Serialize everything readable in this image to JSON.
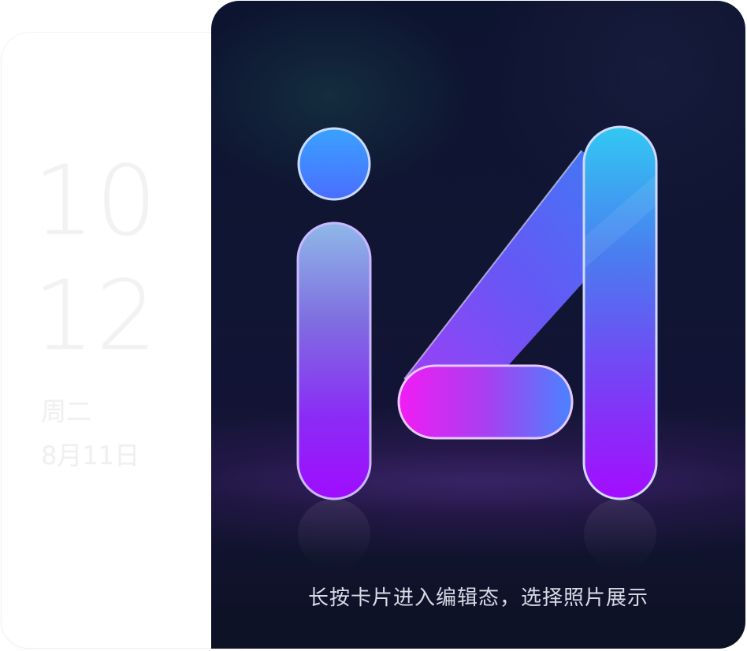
{
  "clock_widget": {
    "hour": "10",
    "minute": "12",
    "weekday": "周二",
    "date": "8月11日"
  },
  "photo_widget": {
    "logo": "i4",
    "hint": "长按卡片进入编辑态，选择照片展示"
  },
  "colors": {
    "card_dark": "#0f1533",
    "accent_blue": "#3a8bff",
    "accent_cyan": "#35c9f0",
    "accent_purple": "#a100ff",
    "accent_magenta": "#ef1cf5"
  }
}
